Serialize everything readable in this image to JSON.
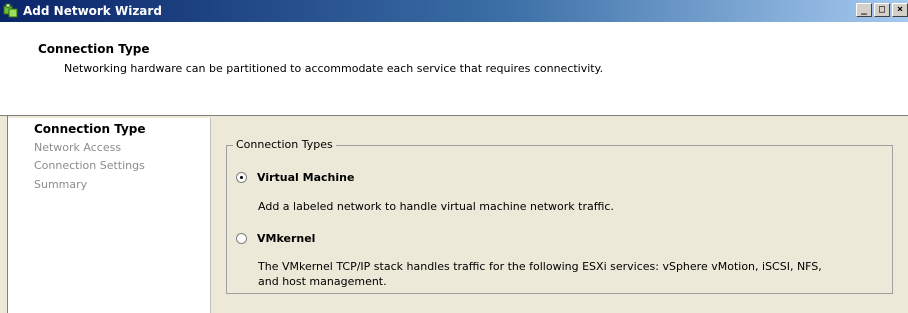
{
  "window": {
    "title": "Add Network Wizard",
    "buttons": {
      "minimize": "_",
      "maximize": "□",
      "close": "×"
    }
  },
  "header": {
    "title": "Connection Type",
    "description": "Networking hardware can be partitioned to accommodate each service that requires connectivity."
  },
  "nav": {
    "items": [
      {
        "label": "Connection Type",
        "active": true
      },
      {
        "label": "Network Access",
        "active": false
      },
      {
        "label": "Connection Settings",
        "active": false
      },
      {
        "label": "Summary",
        "active": false
      }
    ]
  },
  "connection_types": {
    "legend": "Connection Types",
    "options": [
      {
        "label": "Virtual Machine",
        "checked": true,
        "description": "Add a labeled network to handle virtual machine network traffic."
      },
      {
        "label": "VMkernel",
        "checked": false,
        "description_line1": "The VMkernel TCP/IP stack handles traffic for the following ESXi services: vSphere vMotion, iSCSI, NFS,",
        "description_line2": "and host management."
      }
    ]
  },
  "colors": {
    "title_bar_start": "#0a246a",
    "title_bar_end": "#a6caf0",
    "dialog_bg": "#ece9d8",
    "disabled_text": "#8c8c8c"
  }
}
